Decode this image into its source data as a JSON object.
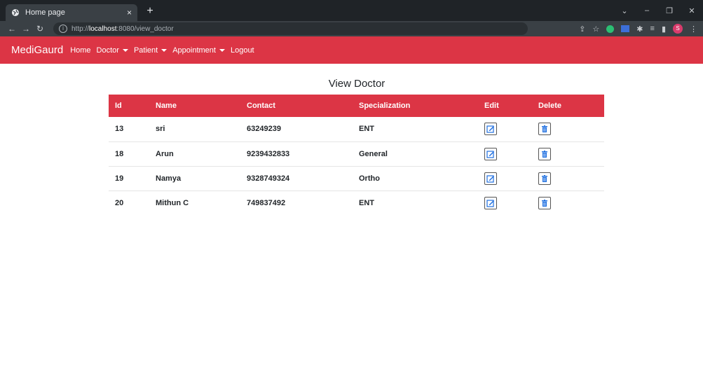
{
  "browser": {
    "tab_title": "Home page",
    "tab_close": "×",
    "new_tab": "+",
    "url_prefix": "http://",
    "url_host": "localhost",
    "url_rest": ":8080/view_doctor",
    "profile_initial": "S"
  },
  "navbar": {
    "brand": "MediGaurd",
    "items": [
      {
        "label": "Home",
        "dropdown": false
      },
      {
        "label": "Doctor",
        "dropdown": true
      },
      {
        "label": "Patient",
        "dropdown": true
      },
      {
        "label": "Appointment",
        "dropdown": true
      },
      {
        "label": "Logout",
        "dropdown": false
      }
    ],
    "color": "#dc3545"
  },
  "page": {
    "title": "View Doctor"
  },
  "table": {
    "headers": [
      "Id",
      "Name",
      "Contact",
      "Specialization",
      "Edit",
      "Delete"
    ],
    "rows": [
      {
        "id": "13",
        "name": "sri",
        "contact": "63249239",
        "specialization": "ENT"
      },
      {
        "id": "18",
        "name": "Arun",
        "contact": "9239432833",
        "specialization": "General"
      },
      {
        "id": "19",
        "name": "Namya",
        "contact": "9328749324",
        "specialization": "Ortho"
      },
      {
        "id": "20",
        "name": "Mithun C",
        "contact": "749837492",
        "specialization": "ENT"
      }
    ],
    "icons": {
      "edit": "edit-icon",
      "delete": "trash-icon"
    },
    "icon_color": "#1e6fe0"
  }
}
